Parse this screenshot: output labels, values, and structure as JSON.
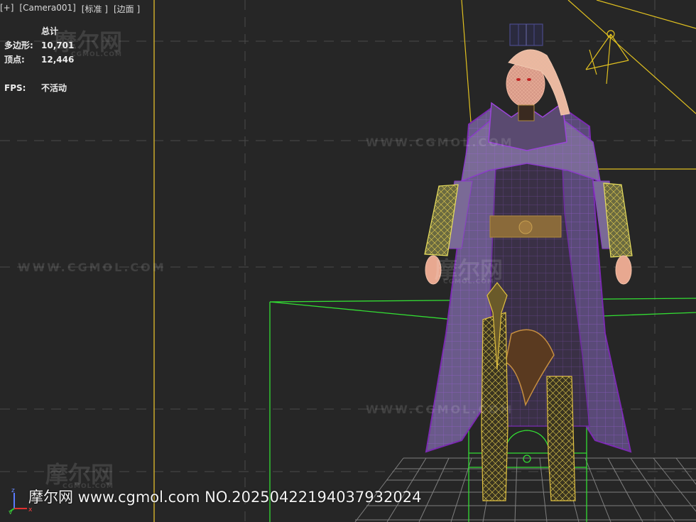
{
  "viewport": {
    "header": {
      "plus_label": "[+]",
      "camera_label": "[Camera001]",
      "shading_label": "[标准 ]",
      "edges_label": "[边面 ]"
    },
    "stats": {
      "total_label": "总计",
      "polygons_label": "多边形:",
      "polygons_value": "10,701",
      "vertices_label": "顶点:",
      "vertices_value": "12,446",
      "fps_label": "FPS:",
      "fps_value": "不活动"
    },
    "axis": {
      "z": "z",
      "y": "y",
      "x": "x"
    }
  },
  "watermarks": {
    "site": "WWW.CGMOL.COM",
    "logo": "摩尔网",
    "logo_sub": "CGMOL.COM"
  },
  "footer": {
    "text": "摩尔网 www.cgmol.com NO.20250422194037932024"
  },
  "colors": {
    "background": "#262626",
    "selection_yellow": "#e0c020",
    "bbox_green": "#33dd33",
    "wire_purple": "#8c3cc8",
    "grid_gray": "#9a9a9a"
  }
}
